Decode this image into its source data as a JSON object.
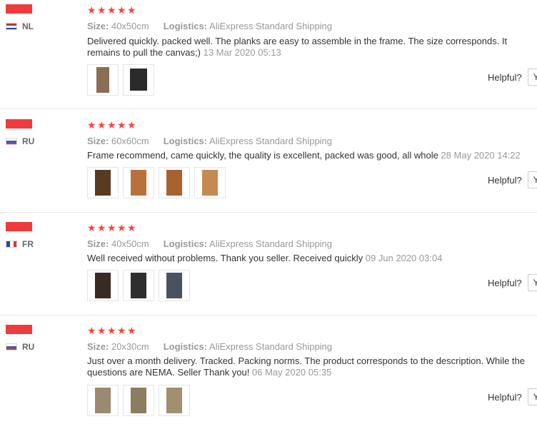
{
  "reviews": [
    {
      "country": "NL",
      "flag": "nl",
      "size_label": "Size:",
      "size": "40x50cm",
      "logistics_label": "Logistics:",
      "logistics": "AliExpress Standard Shipping",
      "text": "Delivered quickly. packed well. The planks are easy to assemble in the frame. The size corresponds. It remains to pull the canvas;)",
      "date": "13 Mar 2020 05:13",
      "helpful_label": "Helpful?",
      "helpful_button": "Y",
      "photos": [
        {
          "color": "#8a6f55"
        },
        {
          "color": "#2b2b2b"
        }
      ]
    },
    {
      "country": "RU",
      "flag": "ru",
      "size_label": "Size:",
      "size": "60x60cm",
      "logistics_label": "Logistics:",
      "logistics": "AliExpress Standard Shipping",
      "text": "Frame recommend, came quickly, the quality is excellent, packed was good, all whole",
      "date": "28 May 2020 14:22",
      "helpful_label": "Helpful?",
      "helpful_button": "Y",
      "photos": [
        {
          "color": "#5a3a22"
        },
        {
          "color": "#b8713a"
        },
        {
          "color": "#a8622e"
        },
        {
          "color": "#c48a52"
        }
      ]
    },
    {
      "country": "FR",
      "flag": "fr",
      "size_label": "Size:",
      "size": "40x50cm",
      "logistics_label": "Logistics:",
      "logistics": "AliExpress Standard Shipping",
      "text": "Well received without problems. Thank you seller. Received quickly",
      "date": "09 Jun 2020 03:04",
      "helpful_label": "Helpful?",
      "helpful_button": "Y",
      "photos": [
        {
          "color": "#3a2a22"
        },
        {
          "color": "#2e2e2e"
        },
        {
          "color": "#4a5260"
        }
      ]
    },
    {
      "country": "RU",
      "flag": "ru",
      "size_label": "Size:",
      "size": "20x30cm",
      "logistics_label": "Logistics:",
      "logistics": "AliExpress Standard Shipping",
      "text": "Just over a month delivery. Tracked. Packing norms. The product corresponds to the description. While the questions are NEMA. Seller Thank you!",
      "date": "06 May 2020 05:35",
      "helpful_label": "Helpful?",
      "helpful_button": "Y",
      "photos": [
        {
          "color": "#9a8a70"
        },
        {
          "color": "#8c7c60"
        },
        {
          "color": "#a09070"
        }
      ]
    }
  ],
  "colors": {
    "star": "#f2463e",
    "name_redaction": "#ef3b3b"
  }
}
